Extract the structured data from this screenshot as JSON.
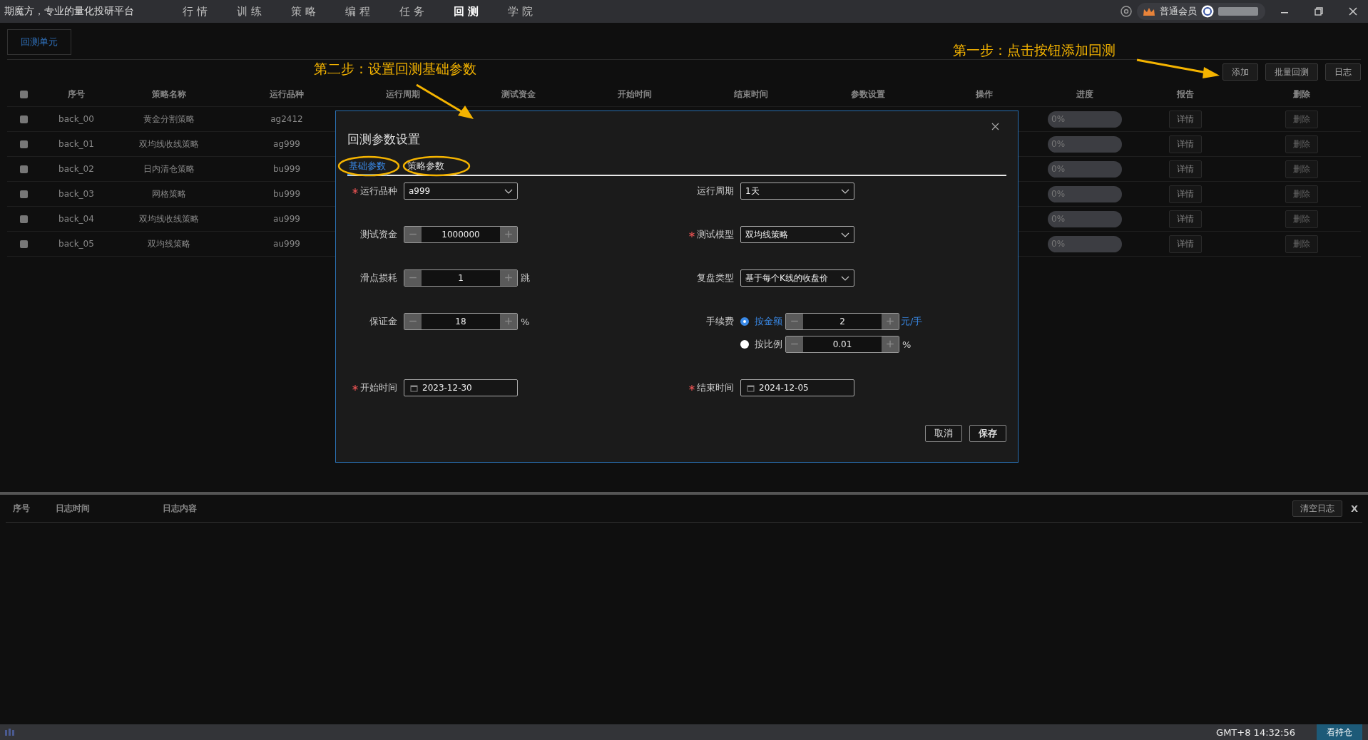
{
  "app_title": "期魔方，专业的量化投研平台",
  "nav": [
    {
      "label": "行情",
      "selected": false
    },
    {
      "label": "训练",
      "selected": false
    },
    {
      "label": "策略",
      "selected": false
    },
    {
      "label": "编程",
      "selected": false
    },
    {
      "label": "任务",
      "selected": false
    },
    {
      "label": "回测",
      "selected": true
    },
    {
      "label": "学院",
      "selected": false
    }
  ],
  "membership": "普通会员",
  "tabs": [
    {
      "label": "回测单元",
      "selected": true
    }
  ],
  "annotations": [
    {
      "text": "第一步：点击按钮添加回测"
    },
    {
      "text": "第二步：设置回测基础参数"
    }
  ],
  "toolbar_buttons": [
    "添加",
    "批量回测",
    "日志"
  ],
  "table": {
    "header_checked": false,
    "columns": [
      "序号",
      "策略名称",
      "运行品种",
      "运行周期",
      "测试资金",
      "开始时间",
      "结束时间",
      "参数设置",
      "操作",
      "进度",
      "报告",
      "删除"
    ],
    "rows": [
      {
        "checked": false,
        "id": "back_00",
        "strategy": "黄金分割策略",
        "symbol": "ag2412",
        "level": 0,
        "progress": "0%",
        "report": "详情",
        "delete": "删除"
      },
      {
        "checked": false,
        "id": "back_01",
        "strategy": "双均线收线策略",
        "symbol": "ag999",
        "level": 0,
        "progress": "0%",
        "report": "详情",
        "delete": "删除"
      },
      {
        "checked": false,
        "id": "back_02",
        "strategy": "日内清仓策略",
        "symbol": "bu999",
        "level": 0,
        "progress": "0%",
        "report": "详情",
        "delete": "删除"
      },
      {
        "checked": false,
        "id": "back_03",
        "strategy": "网格策略",
        "symbol": "bu999",
        "level": 0,
        "progress": "0%",
        "report": "详情",
        "delete": "删除"
      },
      {
        "checked": false,
        "id": "back_04",
        "strategy": "双均线收线策略",
        "symbol": "au999",
        "level": 0,
        "progress": "0%",
        "report": "详情",
        "delete": "删除"
      },
      {
        "checked": false,
        "id": "back_05",
        "strategy": "双均线策略",
        "symbol": "au999",
        "level": 0,
        "progress": "0%",
        "report": "详情",
        "delete": "删除"
      }
    ]
  },
  "dialog": {
    "title": "回测参数设置",
    "tabs": [
      {
        "label": "基础参数",
        "selected": true
      },
      {
        "label": "策略参数",
        "selected": false
      }
    ],
    "rows": [
      {
        "left": {
          "kind": "select",
          "label": "运行品种",
          "required": true,
          "value": "a999"
        },
        "right": {
          "kind": "select",
          "label": "运行周期",
          "required": false,
          "value": "1天"
        }
      },
      {
        "left": {
          "kind": "stepper",
          "label": "测试资金",
          "required": false,
          "value": "1000000"
        },
        "right": {
          "kind": "select",
          "label": "测试模型",
          "required": true,
          "value": "双均线策略"
        }
      },
      {
        "left": {
          "kind": "stepper",
          "label": "滑点损耗",
          "required": false,
          "value": "1",
          "unit": "跳"
        },
        "right": {
          "kind": "select",
          "label": "复盘类型",
          "required": false,
          "value": "基于每个K线的收盘价"
        }
      },
      {
        "left": {
          "kind": "stepper",
          "label": "保证金",
          "required": false,
          "value": "18",
          "unit": "%"
        },
        "right": {
          "kind": "fee",
          "label": "手续费",
          "required": false,
          "options": [
            {
              "label": "按金额",
              "selected": true,
              "value": "2",
              "unit": "元/手"
            },
            {
              "label": "按比例",
              "selected": false,
              "value": "0.01",
              "unit": "%"
            }
          ]
        }
      },
      {
        "left": {
          "kind": "date",
          "label": "开始时间",
          "required": true,
          "value": "2023-12-30"
        },
        "right": {
          "kind": "date",
          "label": "结束时间",
          "required": true,
          "value": "2024-12-05"
        }
      }
    ],
    "buttons": [
      "取消",
      "保存"
    ]
  },
  "log": {
    "columns": [
      "序号",
      "日志时间",
      "日志内容"
    ],
    "clear_button": "清空日志",
    "close": "X"
  },
  "status_bar": {
    "time": "GMT+8 14:32:56",
    "button": "看持仓"
  }
}
